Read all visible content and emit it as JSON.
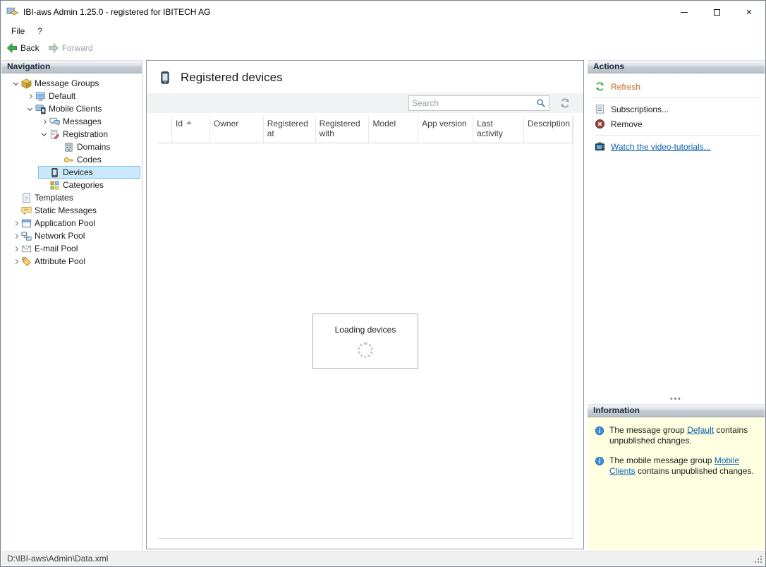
{
  "colors": {
    "selection_bg": "#cbe8fa",
    "selection_border": "#7fc3ea",
    "info_panel_bg": "#ffffe1",
    "link_blue": "#0a60b6",
    "refresh_label": "#c2641b"
  },
  "window": {
    "title": "IBI-aws Admin 1.25.0 - registered for IBITECH AG"
  },
  "menu": {
    "items": [
      {
        "label": "File"
      },
      {
        "label": "?"
      }
    ]
  },
  "toolbar": {
    "back_label": "Back",
    "forward_label": "Forward"
  },
  "navigation": {
    "header": "Navigation",
    "tree": [
      {
        "label": "Message Groups",
        "icon": "message-groups",
        "level": 0,
        "expander": "expanded"
      },
      {
        "label": "Default",
        "icon": "default",
        "level": 1,
        "expander": "collapsed"
      },
      {
        "label": "Mobile Clients",
        "icon": "mobile-clients",
        "level": 1,
        "expander": "expanded"
      },
      {
        "label": "Messages",
        "icon": "messages",
        "level": 2,
        "expander": "collapsed"
      },
      {
        "label": "Registration",
        "icon": "registration",
        "level": 2,
        "expander": "expanded"
      },
      {
        "label": "Domains",
        "icon": "domains",
        "level": 3,
        "expander": "none"
      },
      {
        "label": "Codes",
        "icon": "codes",
        "level": 3,
        "expander": "none"
      },
      {
        "label": "Devices",
        "icon": "devices",
        "level": 2,
        "expander": "none",
        "selected": true
      },
      {
        "label": "Categories",
        "icon": "categories",
        "level": 2,
        "expander": "none"
      },
      {
        "label": "Templates",
        "icon": "templates",
        "level": 0,
        "expander": "none"
      },
      {
        "label": "Static Messages",
        "icon": "static-messages",
        "level": 0,
        "expander": "none"
      },
      {
        "label": "Application Pool",
        "icon": "application-pool",
        "level": 0,
        "expander": "collapsed"
      },
      {
        "label": "Network Pool",
        "icon": "network-pool",
        "level": 0,
        "expander": "collapsed"
      },
      {
        "label": "E-mail Pool",
        "icon": "email-pool",
        "level": 0,
        "expander": "collapsed"
      },
      {
        "label": "Attribute Pool",
        "icon": "attribute-pool",
        "level": 0,
        "expander": "collapsed"
      }
    ]
  },
  "main": {
    "title": "Registered devices",
    "search": {
      "placeholder": "Search"
    },
    "table": {
      "columns": [
        {
          "label": "Id",
          "sort": "asc"
        },
        {
          "label": "Owner"
        },
        {
          "label": "Registered at"
        },
        {
          "label": "Registered with"
        },
        {
          "label": "Model"
        },
        {
          "label": "App version"
        },
        {
          "label": "Last activity"
        },
        {
          "label": "Description"
        }
      ]
    },
    "loading_text": "Loading devices"
  },
  "actions": {
    "header": "Actions",
    "items": [
      {
        "label": "Refresh",
        "icon": "refresh",
        "style": "orange",
        "separator_after": true
      },
      {
        "label": "Subscriptions...",
        "icon": "subscriptions"
      },
      {
        "label": "Remove",
        "icon": "remove",
        "separator_after": true
      },
      {
        "label": "Watch the video-tutorials...",
        "icon": "tv",
        "style": "link"
      }
    ]
  },
  "information": {
    "header": "Information",
    "notes": [
      {
        "prefix": "The message group ",
        "link": "Default",
        "suffix": " contains unpublished changes."
      },
      {
        "prefix": "The mobile message group ",
        "link": "Mobile Clients",
        "suffix": " contains unpublished changes."
      }
    ]
  },
  "status_bar": {
    "path": "D:\\IBI-aws\\Admin\\Data.xml"
  }
}
